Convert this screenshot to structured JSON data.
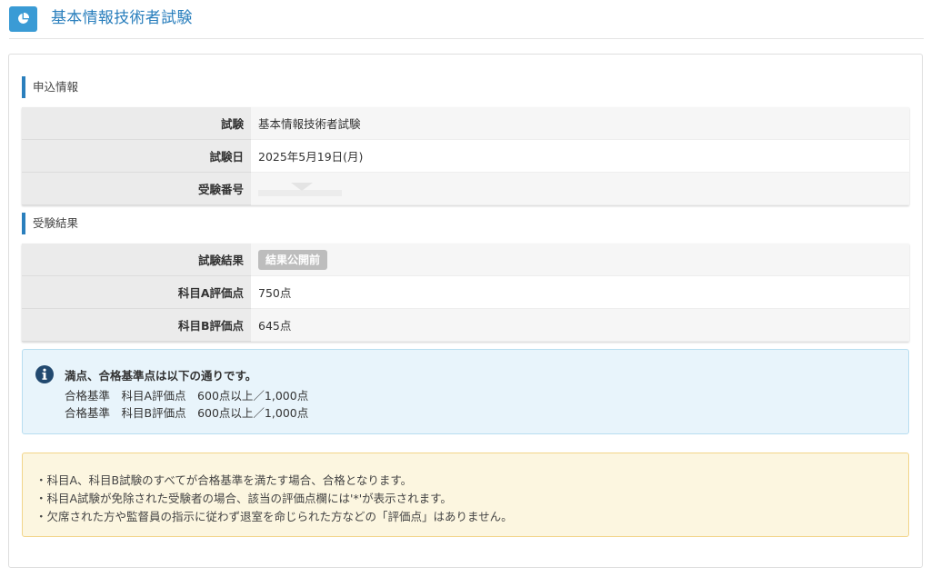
{
  "header": {
    "title": "基本情報技術者試験",
    "icon": "pie-chart-icon",
    "accent_color": "#3a9bd5"
  },
  "application_info": {
    "section_title": "申込情報",
    "rows": [
      {
        "label": "試験",
        "value": "基本情報技術者試験"
      },
      {
        "label": "試験日",
        "value": "2025年5月19日(月)"
      },
      {
        "label": "受験番号",
        "value": ""
      }
    ]
  },
  "exam_result": {
    "section_title": "受験結果",
    "rows": [
      {
        "label": "試験結果",
        "badge": "結果公開前"
      },
      {
        "label": "科目A評価点",
        "value": "750点"
      },
      {
        "label": "科目B評価点",
        "value": "645点"
      }
    ]
  },
  "info_alert": {
    "icon": "info-circle-icon",
    "title": "満点、合格基準点は以下の通りです。",
    "lines": [
      "合格基準　科目A評価点　600点以上／1,000点",
      "合格基準　科目B評価点　600点以上／1,000点"
    ]
  },
  "notes": {
    "lines": [
      "・科目A、科目B試験のすべてが合格基準を満たす場合、合格となります。",
      "・科目A試験が免除された受験者の場合、該当の評価点欄には'*'が表示されます。",
      "・欠席された方や監督員の指示に従わず退室を命じられた方などの「評価点」はありません。"
    ]
  }
}
